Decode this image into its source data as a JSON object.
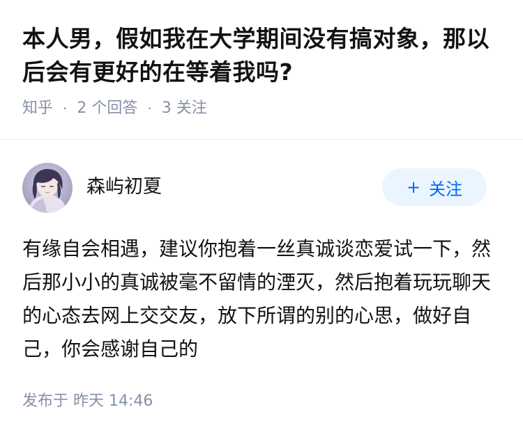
{
  "question": {
    "title": "本人男，假如我在大学期间没有搞对象，那以后会有更好的在等着我吗?",
    "source": "知乎",
    "separator": "·",
    "answer_count": "2 个回答",
    "follower_count": "3 关注"
  },
  "author": {
    "name": "森屿初夏",
    "follow_label": "关注",
    "follow_icon": "plus-icon"
  },
  "answer": {
    "content": "有缘自会相遇，建议你抱着一丝真诚谈恋爱试一下，然后那小小的真诚被毫不留情的湮灭，然后抱着玩玩聊天的心态去网上交交友，放下所谓的别的心思，做好自己，你会感谢自己的",
    "published": "发布于  昨天 14:46"
  },
  "colors": {
    "primary_text": "#121212",
    "meta_text": "#8590a6",
    "accent": "#0066ff",
    "follow_bg": "#ebf5ff"
  }
}
